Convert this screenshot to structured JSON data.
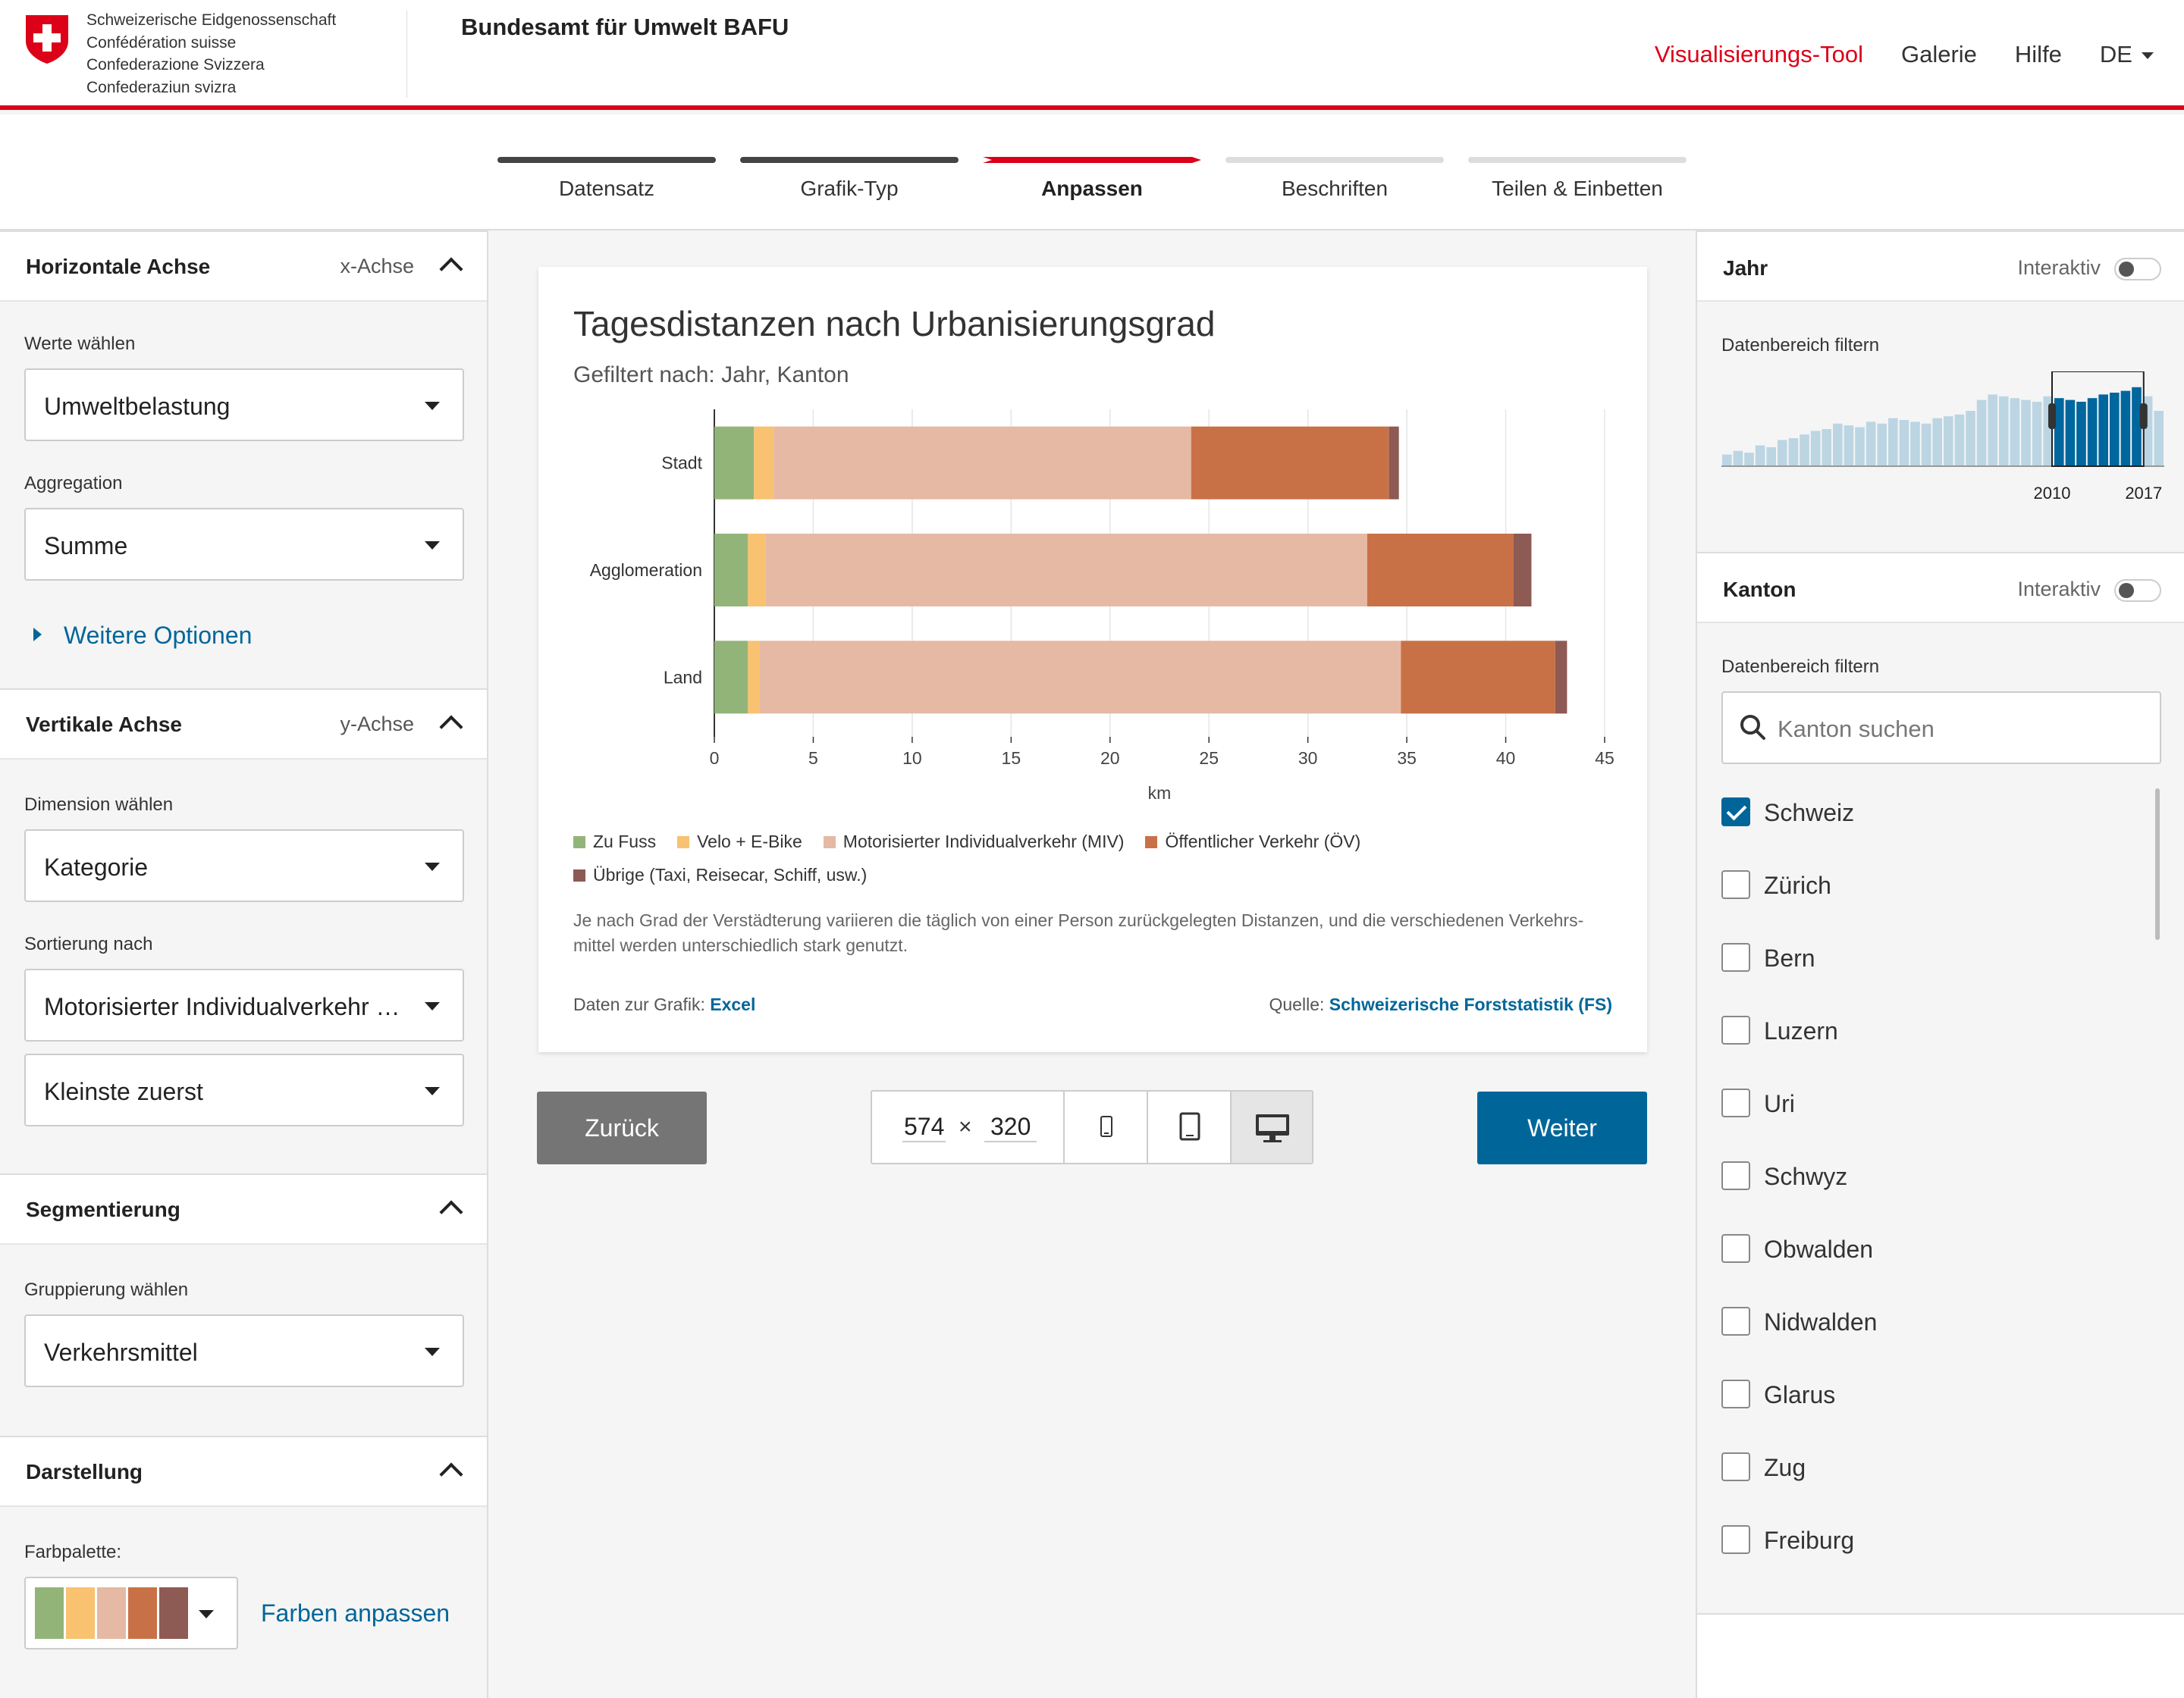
{
  "header": {
    "confederation_lines": [
      "Schweizerische Eidgenossenschaft",
      "Confédération suisse",
      "Confederazione Svizzera",
      "Confederaziun svizra"
    ],
    "office": "Bundesamt für Umwelt BAFU",
    "nav": {
      "tool": "Visualisierungs-Tool",
      "gallery": "Galerie",
      "help": "Hilfe",
      "lang": "DE"
    }
  },
  "steps": [
    {
      "label": "Datensatz",
      "state": "done"
    },
    {
      "label": "Grafik-Typ",
      "state": "done"
    },
    {
      "label": "Anpassen",
      "state": "current"
    },
    {
      "label": "Beschriften",
      "state": "todo"
    },
    {
      "label": "Teilen & Einbetten",
      "state": "todo"
    }
  ],
  "left": {
    "x_axis": {
      "title": "Horizontale Achse",
      "tag": "x-Achse",
      "values_label": "Werte wählen",
      "values": "Umweltbelastung",
      "agg_label": "Aggregation",
      "agg": "Summe",
      "more": "Weitere Optionen"
    },
    "y_axis": {
      "title": "Vertikale Achse",
      "tag": "y-Achse",
      "dim_label": "Dimension wählen",
      "dim": "Kategorie",
      "sort_label": "Sortierung nach",
      "sort": "Motorisierter Individualverkehr (MIV)",
      "order": "Kleinste zuerst"
    },
    "segment": {
      "title": "Segmentierung",
      "group_label": "Gruppierung wählen",
      "group": "Verkehrsmittel"
    },
    "display": {
      "title": "Darstellung",
      "palette_label": "Farbpalette:",
      "adjust": "Farben anpassen"
    }
  },
  "chart_data": {
    "type": "bar",
    "orientation": "horizontal",
    "stacked": true,
    "title": "Tagesdistanzen nach Urbanisierungsgrad",
    "subtitle": "Gefiltert nach: Jahr, Kanton",
    "categories": [
      "Stadt",
      "Agglomeration",
      "Land"
    ],
    "xlabel": "km",
    "xlim": [
      0,
      45
    ],
    "xticks": [
      0,
      5,
      10,
      15,
      20,
      25,
      30,
      35,
      40,
      45
    ],
    "grid": true,
    "legend_position": "bottom",
    "series": [
      {
        "name": "Zu Fuss",
        "color": "#93b479",
        "values": [
          2.0,
          1.7,
          1.7
        ]
      },
      {
        "name": "Velo + E-Bike",
        "color": "#f8c271",
        "values": [
          1.0,
          0.9,
          0.6
        ]
      },
      {
        "name": "Motorisierter Individualverkehr (MIV)",
        "color": "#e5b9a4",
        "values": [
          21.1,
          30.4,
          32.4
        ]
      },
      {
        "name": "Öffentlicher Verkehr (ÖV)",
        "color": "#c97146",
        "values": [
          10.0,
          7.4,
          7.8
        ]
      },
      {
        "name": "Übrige (Taxi, Reisecar, Schiff, usw.)",
        "color": "#8d5a54",
        "values": [
          0.5,
          0.9,
          0.6
        ]
      }
    ],
    "description": "Je nach Grad der Verstädterung variieren die täglich von einer Person zurückgelegten Distanzen, und die verschiedenen Verkehrs- mittel werden unterschiedlich stark genutzt.",
    "data_label": "Daten zur Grafik:",
    "data_link": "Excel",
    "source_label": "Quelle:",
    "source_link": "Schweizerische Forststatistik (FS)"
  },
  "controls": {
    "back": "Zurück",
    "next": "Weiter",
    "width": "574",
    "times": "×",
    "height": "320",
    "devices": [
      "phone-icon",
      "tablet-icon",
      "desktop-icon"
    ],
    "active_device": "desktop"
  },
  "right": {
    "year": {
      "title": "Jahr",
      "interactive": "Interaktiv",
      "filter_label": "Datenbereich filtern",
      "start": "2010",
      "end": "2017",
      "histogram": [
        0.12,
        0.16,
        0.14,
        0.22,
        0.2,
        0.28,
        0.3,
        0.34,
        0.38,
        0.4,
        0.46,
        0.44,
        0.42,
        0.48,
        0.46,
        0.52,
        0.5,
        0.48,
        0.46,
        0.52,
        0.54,
        0.56,
        0.6,
        0.72,
        0.78,
        0.76,
        0.74,
        0.72,
        0.7,
        0.76,
        0.74,
        0.72,
        0.7,
        0.74,
        0.78,
        0.8,
        0.82,
        0.86,
        0.76,
        0.6
      ],
      "selected_from": 30,
      "selected_to": 37
    },
    "canton": {
      "title": "Kanton",
      "interactive": "Interaktiv",
      "filter_label": "Datenbereich filtern",
      "search_placeholder": "Kanton suchen",
      "items": [
        {
          "label": "Schweiz",
          "checked": true
        },
        {
          "label": "Zürich",
          "checked": false
        },
        {
          "label": "Bern",
          "checked": false
        },
        {
          "label": "Luzern",
          "checked": false
        },
        {
          "label": "Uri",
          "checked": false
        },
        {
          "label": "Schwyz",
          "checked": false
        },
        {
          "label": "Obwalden",
          "checked": false
        },
        {
          "label": "Nidwalden",
          "checked": false
        },
        {
          "label": "Glarus",
          "checked": false
        },
        {
          "label": "Zug",
          "checked": false
        },
        {
          "label": "Freiburg",
          "checked": false
        }
      ]
    }
  },
  "colors": {
    "accent_red": "#dc0018",
    "link_blue": "#006699",
    "year_selected": "#00669e",
    "year_bar": "#bcd5e3"
  }
}
